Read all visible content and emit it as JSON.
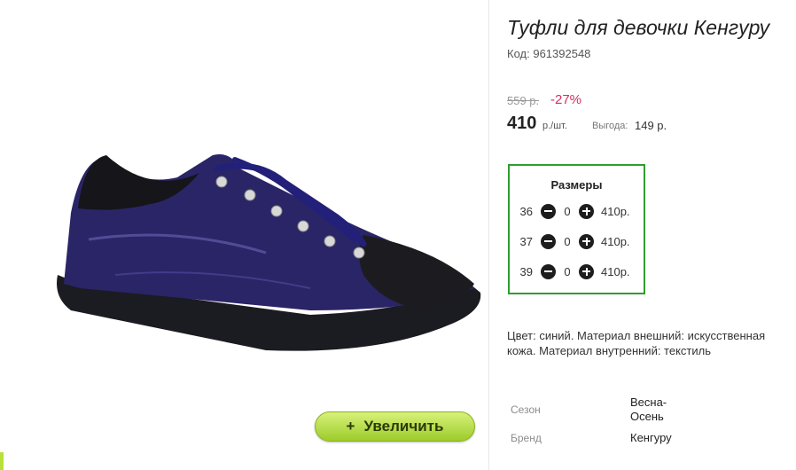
{
  "product": {
    "title": "Туфли для девочки Кенгуру",
    "code_label": "Код:",
    "code": "961392548",
    "old_price": "559 р.",
    "discount": "-27%",
    "price": "410",
    "price_unit": "р./шт.",
    "savings_label": "Выгода:",
    "savings_value": "149 р."
  },
  "gallery": {
    "zoom_label": "Увеличить",
    "zoom_icon": "plus-icon",
    "image": "blue-patent-sneaker"
  },
  "sizes": {
    "title": "Размеры",
    "rows": [
      {
        "size": "36",
        "qty": "0",
        "price": "410р."
      },
      {
        "size": "37",
        "qty": "0",
        "price": "410р."
      },
      {
        "size": "39",
        "qty": "0",
        "price": "410р."
      }
    ]
  },
  "description": "Цвет: синий. Материал внешний: искусственная кожа. Материал внутренний: текстиль",
  "specs": [
    {
      "label": "Сезон",
      "value": "Весна-\nОсень"
    },
    {
      "label": "Бренд",
      "value": "Кенгуру"
    }
  ],
  "colors": {
    "accent_green": "#2e9e2e",
    "discount": "#d32f5f",
    "zoom_button": "#b5e03a"
  }
}
